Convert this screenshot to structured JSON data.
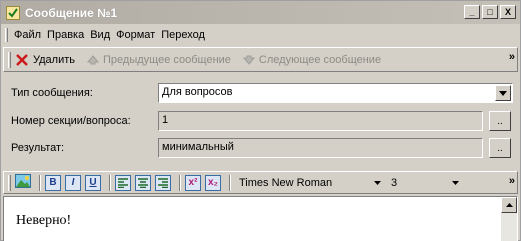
{
  "window": {
    "title": "Сообщение №1",
    "controls": {
      "minimize": "_",
      "maximize": "□",
      "close": "X"
    }
  },
  "menu": {
    "items": [
      {
        "label": "Файл"
      },
      {
        "label": "Правка"
      },
      {
        "label": "Вид"
      },
      {
        "label": "Формат"
      },
      {
        "label": "Переход"
      }
    ]
  },
  "toolbar": {
    "delete_label": "Удалить",
    "prev_label": "Предыдущее сообщение",
    "next_label": "Следующее сообщение",
    "overflow": "»"
  },
  "form": {
    "type": {
      "label": "Тип сообщения:",
      "value": "Для вопросов"
    },
    "section": {
      "label": "Номер секции/вопроса:",
      "value": "1",
      "button": ".."
    },
    "result": {
      "label": "Результат:",
      "value": "минимальный",
      "button": ".."
    }
  },
  "format_toolbar": {
    "bold": "B",
    "italic": "I",
    "underline": "U",
    "superscript": "x²",
    "subscript": "x₂",
    "font_name": "Times New Roman",
    "font_size": "3",
    "overflow": "»"
  },
  "editor": {
    "text": "Неверно!"
  },
  "colors": {
    "face": "#d4d0c8",
    "accent": "#3a6ea5",
    "delete_red": "#cc1a1a",
    "disabled": "#8c8a84"
  }
}
